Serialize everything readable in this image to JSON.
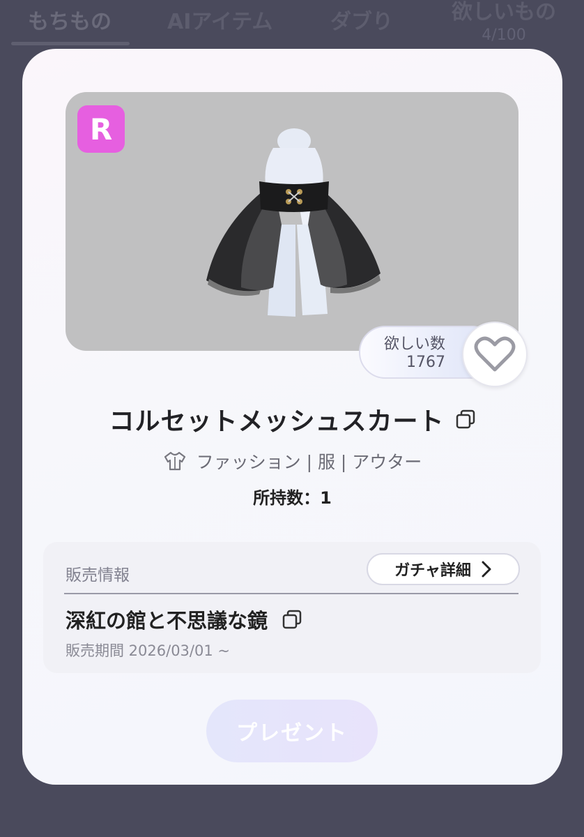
{
  "tabs": [
    {
      "label": "もちもの"
    },
    {
      "label": "AIアイテム"
    },
    {
      "label": "ダブり"
    },
    {
      "label": "欲しいもの",
      "count": "4/100"
    }
  ],
  "item": {
    "rarity": "R",
    "name": "コルセットメッシュスカート",
    "wish_label": "欲しい数",
    "wish_count": "1767",
    "category": "ファッション | 服 | アウター",
    "owned": "所持数：1"
  },
  "sale": {
    "header": "販売情報",
    "gacha_button": "ガチャ詳細",
    "gacha_name": "深紅の館と不思議な鏡",
    "period": "販売期間 2026/03/01 ~"
  },
  "actions": {
    "present": "プレゼント"
  },
  "colors": {
    "rarity_badge": "#e65fe0",
    "background": "#4a4a5c"
  }
}
